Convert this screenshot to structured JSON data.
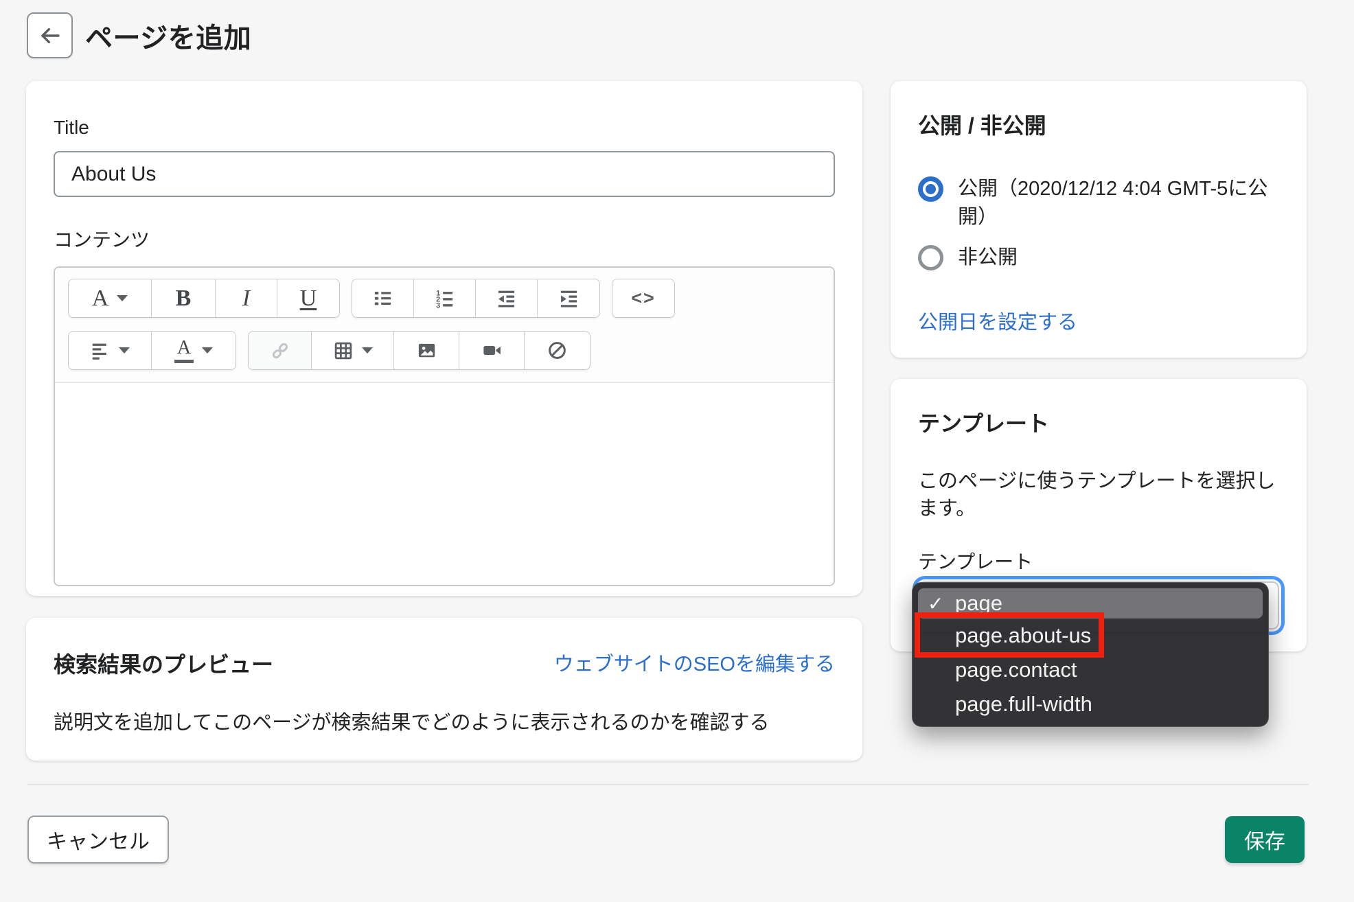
{
  "header": {
    "title": "ページを追加"
  },
  "editor_card": {
    "title_label": "Title",
    "title_value": "About Us",
    "content_label": "コンテンツ",
    "toolbar": {
      "format_label": "A",
      "bold_label": "B",
      "italic_label": "I",
      "underline_label": "U",
      "code_label": "<>"
    }
  },
  "visibility_card": {
    "heading": "公開 / 非公開",
    "options": [
      {
        "label": "公開（2020/12/12 4:04 GMT-5に公開）",
        "selected": true
      },
      {
        "label": "非公開",
        "selected": false
      }
    ],
    "link": "公開日を設定する"
  },
  "template_card": {
    "heading": "テンプレート",
    "description": "このページに使うテンプレートを選択します。",
    "select_label": "テンプレート",
    "selected_value": "page",
    "checkmark": "✓",
    "dropdown_options": [
      "page",
      "page.about-us",
      "page.contact",
      "page.full-width"
    ],
    "annotated_option": "page.about-us"
  },
  "seo_card": {
    "heading": "検索結果のプレビュー",
    "edit_link": "ウェブサイトのSEOを編集する",
    "description": "説明文を追加してこのページが検索結果でどのように表示されるのかを確認する"
  },
  "footer": {
    "cancel_label": "キャンセル",
    "save_label": "保存"
  },
  "colors": {
    "page_background": "#f6f6f7",
    "accent_green": "#0a8467",
    "link_blue": "#2c6ecb",
    "radio_blue": "#2c6ecb",
    "focus_ring_blue": "#4c9aff",
    "annotation_red": "#ee2110",
    "dropdown_background": "#2f2f31"
  }
}
